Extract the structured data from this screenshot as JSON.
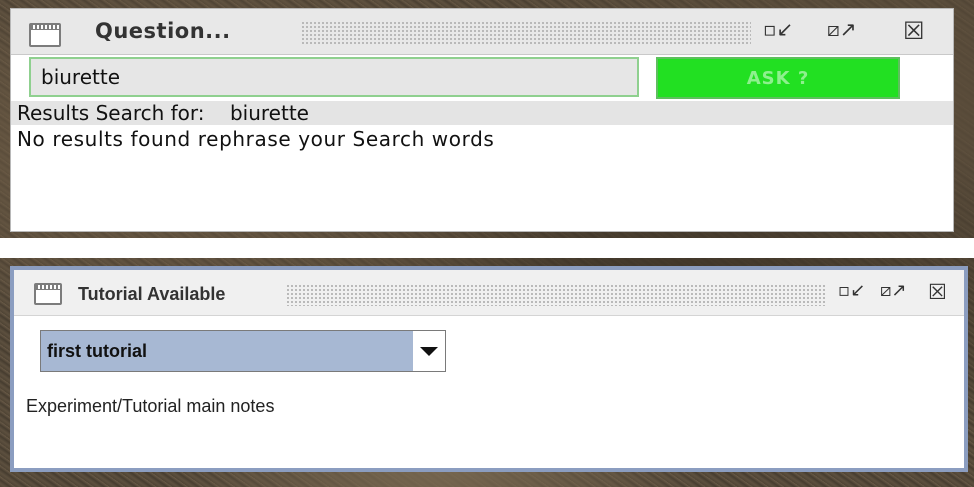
{
  "question_window": {
    "title": "Question...",
    "search_value": "biurette",
    "ask_button": "ASK ?",
    "results_label": "Results Search for:",
    "results_term": "biurette",
    "no_results_message": "No results found rephrase your Search words",
    "controls": {
      "minimize_icon": "minimize-icon",
      "maximize_icon": "maximize-icon",
      "close_icon": "close-icon"
    },
    "ask_button_color": "#22e022"
  },
  "tutorial_window": {
    "title": "Tutorial Available",
    "selected_tutorial": "first tutorial",
    "notes_label": "Experiment/Tutorial main notes",
    "controls": {
      "minimize_icon": "minimize-icon",
      "maximize_icon": "maximize-icon",
      "close_icon": "close-icon"
    },
    "select_highlight_color": "#a7b8d3",
    "border_color": "#8b9dc0"
  }
}
